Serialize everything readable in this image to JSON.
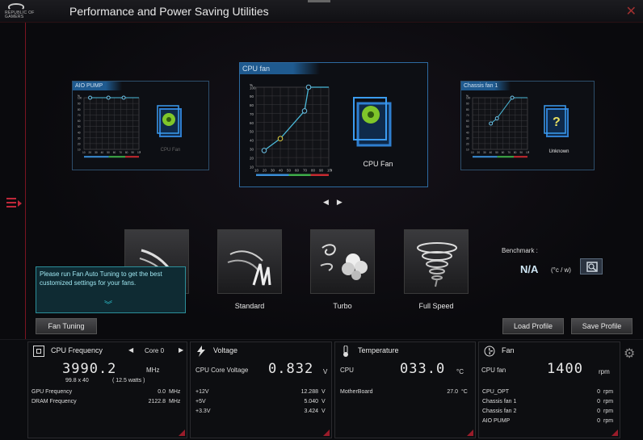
{
  "titlebar": {
    "title": "Performance and Power Saving Utilities",
    "logo_text": "REPUBLIC OF GAMERS"
  },
  "panels": {
    "aio": {
      "title": "AIO PUMP",
      "fan_label": "CPU Fan"
    },
    "cpu": {
      "title": "CPU fan",
      "fan_label": "CPU Fan"
    },
    "chassis": {
      "title": "Chassis fan 1",
      "fan_label": "Unknown"
    }
  },
  "modes": {
    "standard": "Standard",
    "turbo": "Turbo",
    "full_speed": "Full Speed"
  },
  "benchmark": {
    "label": "Benchmark :",
    "value": "N/A",
    "unit": "(°c / w)"
  },
  "tooltip": {
    "text": "Please run Fan Auto Tuning to get the best customized settings for your fans."
  },
  "buttons": {
    "fan_tuning": "Fan Tuning",
    "load_profile": "Load Profile",
    "save_profile": "Save Profile"
  },
  "cpu_freq": {
    "title": "CPU Frequency",
    "core": "Core 0",
    "value": "3990.2",
    "unit": "MHz",
    "ratio": "99.8  x  40",
    "watts": "( 12.5 watts )",
    "rows": [
      {
        "label": "GPU Frequency",
        "value": "0.0",
        "unit": "MHz"
      },
      {
        "label": "DRAM Frequency",
        "value": "2122.8",
        "unit": "MHz"
      }
    ]
  },
  "voltage": {
    "title": "Voltage",
    "main_label": "CPU Core Voltage",
    "main_value": "0.832",
    "main_unit": "V",
    "rows": [
      {
        "label": "+12V",
        "value": "12.288",
        "unit": "V"
      },
      {
        "label": "+5V",
        "value": "5.040",
        "unit": "V"
      },
      {
        "label": "+3.3V",
        "value": "3.424",
        "unit": "V"
      }
    ]
  },
  "temperature": {
    "title": "Temperature",
    "main_label": "CPU",
    "main_value": "033.0",
    "main_unit": "°C",
    "rows": [
      {
        "label": "MotherBoard",
        "value": "27.0",
        "unit": "°C"
      }
    ]
  },
  "fan": {
    "title": "Fan",
    "main_label": "CPU fan",
    "main_value": "1400",
    "main_unit": "rpm",
    "rows": [
      {
        "label": "CPU_OPT",
        "value": "0",
        "unit": "rpm"
      },
      {
        "label": "Chassis fan 1",
        "value": "0",
        "unit": "rpm"
      },
      {
        "label": "Chassis fan 2",
        "value": "0",
        "unit": "rpm"
      },
      {
        "label": "AIO PUMP",
        "value": "0",
        "unit": "rpm"
      }
    ]
  },
  "chart_ticks": {
    "y": [
      "100",
      "90",
      "80",
      "70",
      "60",
      "50",
      "40",
      "30",
      "20",
      "10"
    ],
    "x": [
      "10",
      "20",
      "30",
      "40",
      "50",
      "60",
      "70",
      "80",
      "90",
      "100"
    ],
    "pct": "%",
    "deg": "°C"
  },
  "chart_data": [
    {
      "type": "line",
      "name": "AIO PUMP",
      "x": [
        20,
        50,
        75
      ],
      "y": [
        100,
        100,
        100
      ],
      "xlim": [
        10,
        100
      ],
      "ylim": [
        0,
        100
      ]
    },
    {
      "type": "line",
      "name": "CPU fan",
      "x": [
        20,
        40,
        70,
        75
      ],
      "y": [
        20,
        35,
        70,
        100
      ],
      "xlim": [
        10,
        100
      ],
      "ylim": [
        0,
        100
      ]
    },
    {
      "type": "line",
      "name": "Chassis fan 1",
      "x": [
        40,
        50,
        75
      ],
      "y": [
        50,
        60,
        100
      ],
      "xlim": [
        10,
        100
      ],
      "ylim": [
        0,
        100
      ]
    }
  ],
  "colors": {
    "accent": "#c0283a",
    "curve": "#4ab8d8",
    "panel_border": "#2d6aa0"
  }
}
